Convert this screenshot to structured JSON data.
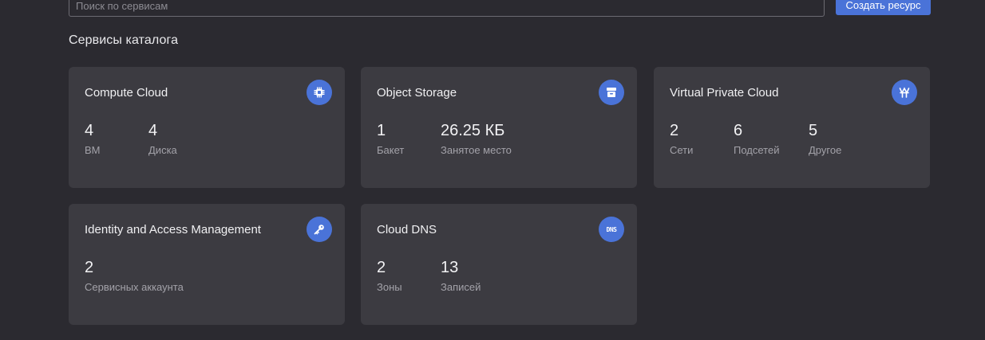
{
  "toolbar": {
    "search_placeholder": "Поиск по сервисам",
    "create_label": "Создать ресурс"
  },
  "section": {
    "title": "Сервисы каталога"
  },
  "colors": {
    "accent": "#4a73d8",
    "background": "#2b2a30",
    "card": "#3c3b41"
  },
  "cards": [
    {
      "title": "Compute Cloud",
      "icon": "chip-icon",
      "stats": [
        {
          "value": "4",
          "label": "ВМ"
        },
        {
          "value": "4",
          "label": "Диска"
        }
      ]
    },
    {
      "title": "Object Storage",
      "icon": "archive-icon",
      "stats": [
        {
          "value": "1",
          "label": "Бакет"
        },
        {
          "value": "26.25 КБ",
          "label": "Занятое место"
        }
      ]
    },
    {
      "title": "Virtual Private Cloud",
      "icon": "network-icon",
      "stats": [
        {
          "value": "2",
          "label": "Сети"
        },
        {
          "value": "6",
          "label": "Подсетей"
        },
        {
          "value": "5",
          "label": "Другое"
        }
      ]
    },
    {
      "title": "Identity and Access Management",
      "icon": "key-icon",
      "stats": [
        {
          "value": "2",
          "label": "Сервисных аккаунта"
        }
      ]
    },
    {
      "title": "Cloud DNS",
      "icon": "dns-icon",
      "icon_text": "DNS",
      "stats": [
        {
          "value": "2",
          "label": "Зоны"
        },
        {
          "value": "13",
          "label": "Записей"
        }
      ]
    }
  ]
}
